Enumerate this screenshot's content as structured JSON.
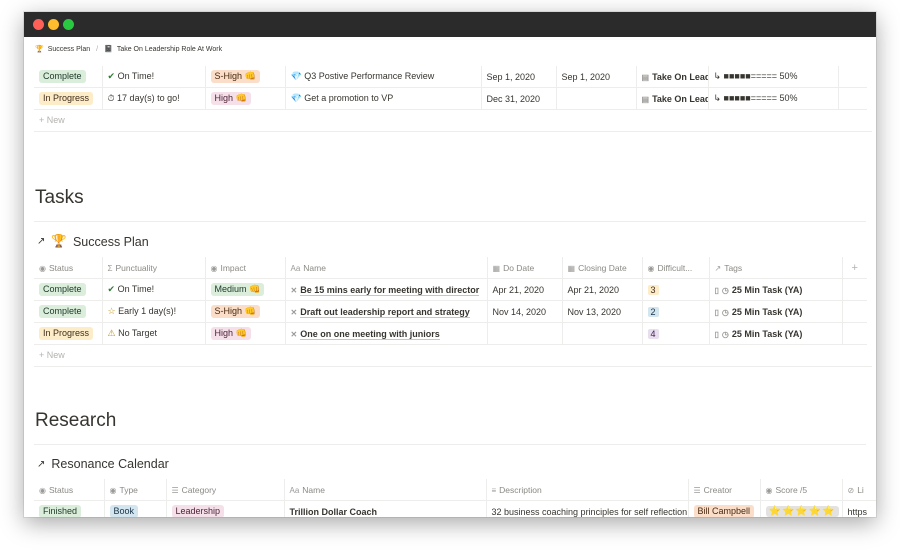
{
  "breadcrumb": {
    "items": [
      {
        "icon": "🏆",
        "label": "Success Plan"
      },
      {
        "icon": "📓",
        "label": "Take On Leadership Role At Work"
      }
    ],
    "separator": "/"
  },
  "goals_table": {
    "rows": [
      {
        "status": "Complete",
        "punctuality_icon": "✔",
        "punctuality": "On Time!",
        "impact": "S-High 👊",
        "name_icon": "💎",
        "name": "Q3 Postive Performance Review",
        "date1": "Sep 1, 2020",
        "date2": "Sep 1, 2020",
        "relation": "Take On Lead",
        "progress": "↳ ■■■■■===== 50%"
      },
      {
        "status": "In Progress",
        "punctuality_icon": "⏱",
        "punctuality": "17 day(s) to go!",
        "impact": "High 👊",
        "name_icon": "💎",
        "name": "Get a promotion to VP",
        "date1": "Dec 31, 2020",
        "date2": "",
        "relation": "Take On Lead",
        "progress": "↳ ■■■■■===== 50%"
      }
    ],
    "new_label": "New"
  },
  "tasks": {
    "heading": "Tasks",
    "db_title": "Success Plan",
    "db_icon": "🏆",
    "columns": [
      "Status",
      "Punctuality",
      "Impact",
      "Name",
      "Do Date",
      "Closing Date",
      "Difficult...",
      "Tags"
    ],
    "rows": [
      {
        "status": "Complete",
        "punctuality_icon": "✔",
        "punctuality": "On Time!",
        "impact": "Medium 👊",
        "name": "Be 15 mins early for meeting with director",
        "do_date": "Apr 21, 2020",
        "closing_date": "Apr 21, 2020",
        "difficulty": "3",
        "tag": "25 Min Task (YA)"
      },
      {
        "status": "Complete",
        "punctuality_icon": "☆",
        "punctuality": "Early 1 day(s)!",
        "impact": "S-High 👊",
        "name": "Draft out leadership report and strategy",
        "do_date": "Nov 14, 2020",
        "closing_date": "Nov 13, 2020",
        "difficulty": "2",
        "tag": "25 Min Task (YA)"
      },
      {
        "status": "In Progress",
        "punctuality_icon": "⚠",
        "punctuality": "No Target",
        "impact": "High 👊",
        "name": "One on one meeting with juniors",
        "do_date": "",
        "closing_date": "",
        "difficulty": "4",
        "tag": "25 Min Task (YA)"
      }
    ],
    "new_label": "New"
  },
  "research": {
    "heading": "Research",
    "db_title": "Resonance Calendar",
    "columns": [
      "Status",
      "Type",
      "Category",
      "Name",
      "Description",
      "Creator",
      "Score /5",
      "Li"
    ],
    "rows": [
      {
        "status": "Finished",
        "type": "Book",
        "category": "Leadership",
        "name": "Trillion Dollar Coach",
        "description": "32 business coaching principles for self reflection",
        "creator": "Bill Campbell",
        "score": "⭐⭐⭐⭐⭐",
        "link": "https"
      }
    ]
  },
  "colors": {
    "accent": "#37352f",
    "titlebar": "#2b2b2b"
  }
}
